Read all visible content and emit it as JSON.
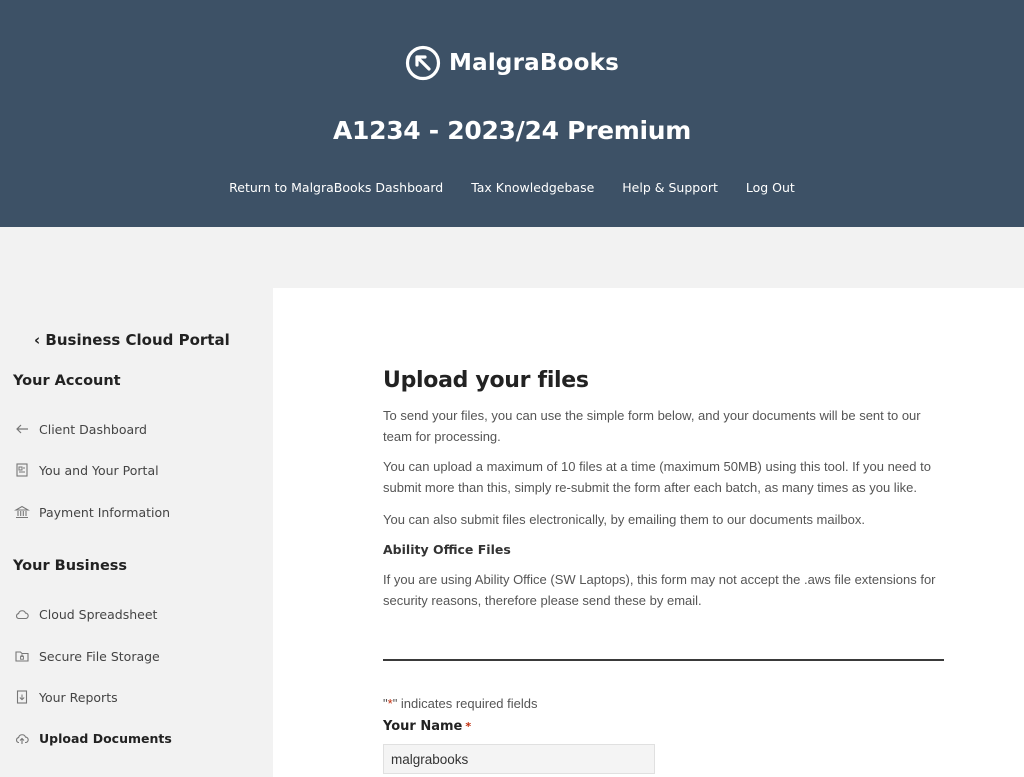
{
  "brand": {
    "name": "MalgraBooks"
  },
  "header": {
    "title": "A1234 - 2023/24 Premium",
    "nav": [
      {
        "label": "Return to MalgraBooks Dashboard"
      },
      {
        "label": "Tax Knowledgebase"
      },
      {
        "label": "Help & Support"
      },
      {
        "label": "Log Out"
      }
    ]
  },
  "sidebar": {
    "back_label": "Business Cloud Portal",
    "sections": [
      {
        "heading": "Your Account",
        "items": [
          {
            "label": "Client Dashboard",
            "icon": "arrow-left-icon"
          },
          {
            "label": "You and Your Portal",
            "icon": "portal-icon"
          },
          {
            "label": "Payment Information",
            "icon": "bank-icon"
          }
        ]
      },
      {
        "heading": "Your Business",
        "items": [
          {
            "label": "Cloud Spreadsheet",
            "icon": "cloud-icon"
          },
          {
            "label": "Secure File Storage",
            "icon": "folder-lock-icon"
          },
          {
            "label": "Your Reports",
            "icon": "report-icon"
          },
          {
            "label": "Upload Documents",
            "icon": "cloud-upload-icon",
            "active": true
          }
        ]
      }
    ]
  },
  "main": {
    "title": "Upload your files",
    "paragraphs": [
      "To send your files, you can use the simple form below, and your documents will be sent to our team for processing.",
      "You can upload a maximum of 10 files at a time (maximum 50MB) using this tool. If you need to submit more than this, simply re-submit the form after each batch, as many times as you like.",
      "You can also submit files electronically, by emailing them to our documents mailbox."
    ],
    "subheading": "Ability Office Files",
    "ability_paragraph": "If you are using Ability Office (SW Laptops), this form may not accept the .aws file extensions for security reasons, therefore please send these by email.",
    "form": {
      "required_note_prefix": "\"",
      "required_note_asterisk": "*",
      "required_note_suffix": "\" indicates required fields",
      "name_label": "Your Name",
      "name_required_mark": "*",
      "name_value": "malgrabooks"
    }
  },
  "colors": {
    "header_bg": "#3d5166",
    "required": "#c02b0a"
  }
}
